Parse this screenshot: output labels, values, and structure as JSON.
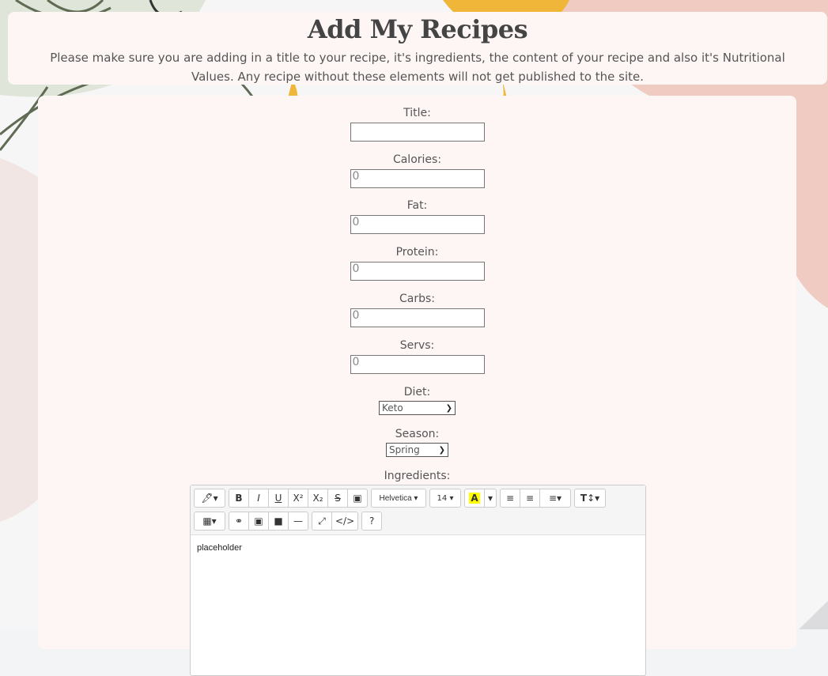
{
  "header": {
    "title": "Add My Recipes",
    "description": "Please make sure you are adding in a title to your recipe, it's ingredients, the content of your recipe and also it's Nutritional Values. Any recipe without these elements will not get published to the site."
  },
  "form": {
    "title_label": "Title:",
    "title_value": "",
    "calories_label": "Calories:",
    "calories_value": "0",
    "fat_label": "Fat:",
    "fat_value": "0",
    "protein_label": "Protein:",
    "protein_value": "0",
    "carbs_label": "Carbs:",
    "carbs_value": "0",
    "servs_label": "Servs:",
    "servs_value": "0",
    "diet_label": "Diet:",
    "diet_selected": "Keto",
    "season_label": "Season:",
    "season_selected": "Spring",
    "ingredients_label": "Ingredients:"
  },
  "editor": {
    "font_family": "Helvetica",
    "font_size": "14",
    "help_label": "?",
    "content": "placeholder",
    "icons": [
      "magic-icon",
      "bold-icon",
      "italic-icon",
      "underline-icon",
      "superscript-icon",
      "subscript-icon",
      "strikethrough-icon",
      "eraser-icon",
      "text-color-icon",
      "unordered-list-icon",
      "ordered-list-icon",
      "align-icon",
      "line-height-icon",
      "table-icon",
      "link-icon",
      "picture-icon",
      "video-icon",
      "hr-icon",
      "fullscreen-icon",
      "code-view-icon",
      "help-icon"
    ]
  },
  "colors": {
    "card_bg": "#fdf6f5",
    "accent_yellow": "#f0b63a",
    "accent_pink": "#efcbc2",
    "leaf_green": "#dfe5d8",
    "leaf_stroke": "#5f6b52"
  }
}
